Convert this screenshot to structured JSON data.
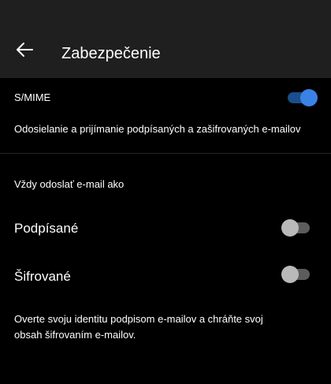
{
  "header": {
    "title": "Zabezpečenie",
    "back_icon": "arrow-left-icon"
  },
  "smime": {
    "label": "S/MIME",
    "enabled": true,
    "description": "Odosielanie a prijímanie podpísaných a zašifrovaných e-mailov"
  },
  "always_send": {
    "heading": "Vždy odoslať e-mail ako",
    "signed": {
      "label": "Podpísané",
      "enabled": false
    },
    "encrypted": {
      "label": "Šifrované",
      "enabled": false
    },
    "info": "Overte svoju identitu podpisom e-mailov a chráňte svoj obsah šifrovaním e-mailov."
  },
  "colors": {
    "background": "#000000",
    "app_bar": "#1f1f1f",
    "toggle_on_knob": "#3b82e6",
    "toggle_on_track": "#1a4e8c",
    "toggle_off_knob": "#b9b9b9",
    "toggle_off_track": "#5c5c5c"
  }
}
